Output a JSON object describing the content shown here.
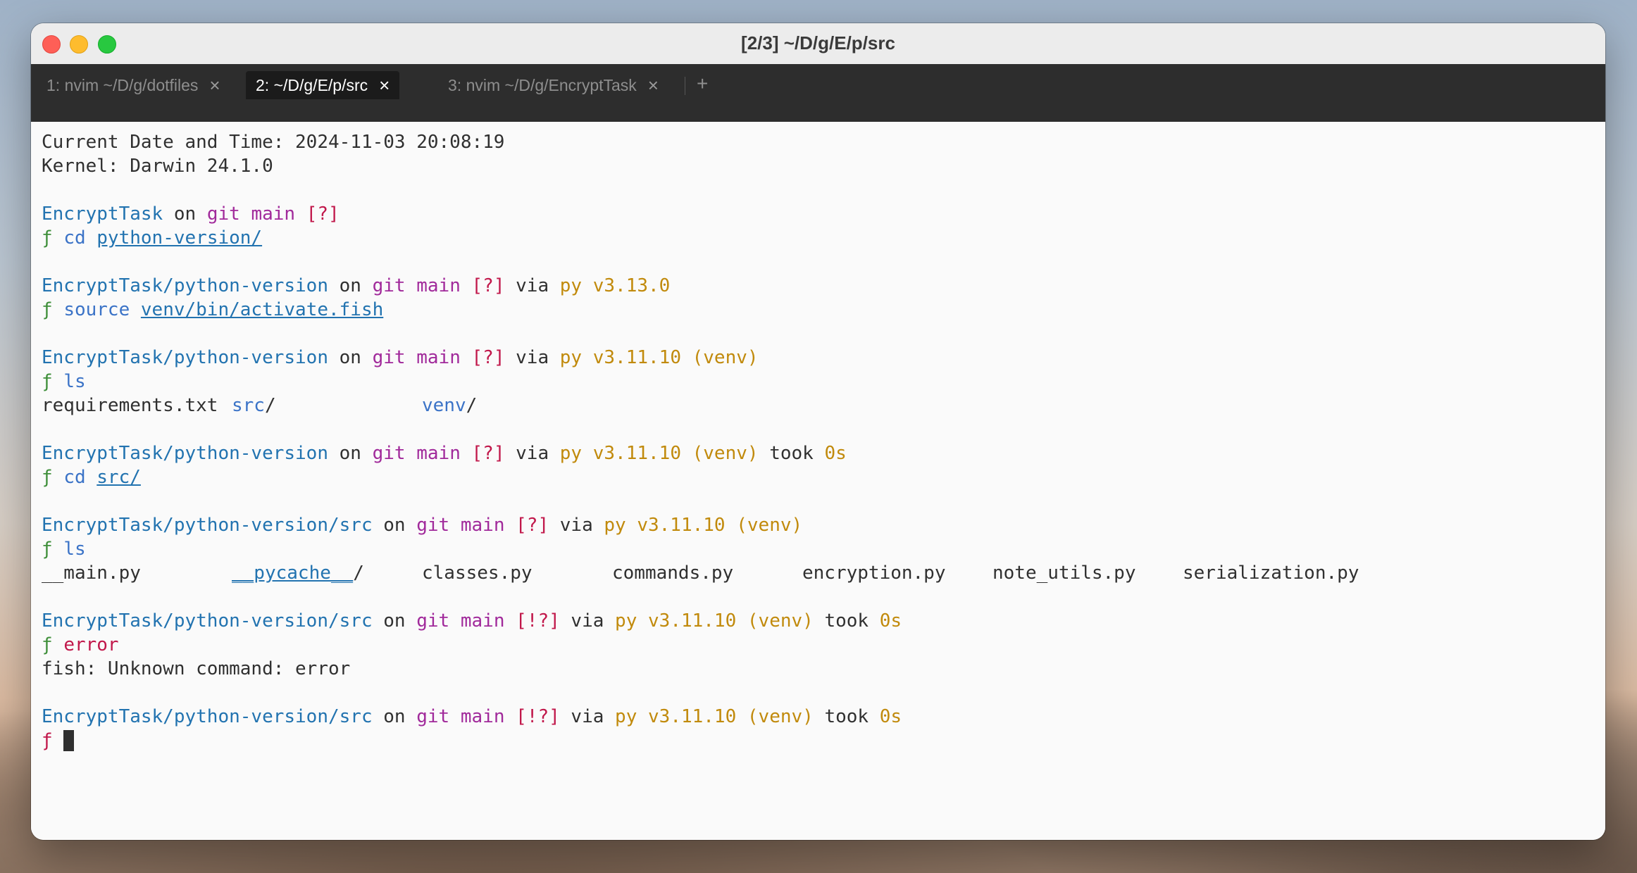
{
  "window": {
    "title": "[2/3] ~/D/g/E/p/src"
  },
  "tabs": [
    {
      "label": "1: nvim ~/D/g/dotfiles",
      "close": "×",
      "active": false
    },
    {
      "label": "2: ~/D/g/E/p/src",
      "close": "×",
      "active": true
    },
    {
      "label": "3: nvim ~/D/g/EncryptTask",
      "close": "×",
      "active": false
    }
  ],
  "new_tab": "+",
  "terminal": {
    "header": {
      "datetime": "Current Date and Time: 2024-11-03 20:08:19",
      "kernel": "Kernel: Darwin 24.1.0"
    },
    "prompt_symbol": "ƒ",
    "words": {
      "on": " on ",
      "git": "git ",
      "via": " via ",
      "took": " took "
    },
    "blocks": [
      {
        "dir": "EncryptTask",
        "branch": "main",
        "status": "[?]",
        "command": "cd",
        "arg": "python-version/"
      },
      {
        "dir": "EncryptTask/python-version",
        "branch": "main",
        "status": "[?]",
        "python": "py v3.13.0",
        "command": "source",
        "arg": "venv/bin/activate.fish"
      },
      {
        "dir": "EncryptTask/python-version",
        "branch": "main",
        "status": "[?]",
        "python": "py v3.11.10 (venv)",
        "command": "ls",
        "output": [
          "requirements.txt",
          "src",
          "venv"
        ]
      },
      {
        "dir": "EncryptTask/python-version",
        "branch": "main",
        "status": "[?]",
        "python": "py v3.11.10 (venv)",
        "took": "0s",
        "command": "cd",
        "arg": "src/"
      },
      {
        "dir": "EncryptTask/python-version/src",
        "branch": "main",
        "status": "[?]",
        "python": "py v3.11.10 (venv)",
        "command": "ls",
        "output": [
          "__main.py",
          "__pycache__",
          "classes.py",
          "commands.py",
          "encryption.py",
          "note_utils.py",
          "serialization.py"
        ]
      },
      {
        "dir": "EncryptTask/python-version/src",
        "branch": "main",
        "status": "[!?]",
        "python": "py v3.11.10 (venv)",
        "took": "0s",
        "command": "error",
        "output_text": "fish: Unknown command: error"
      },
      {
        "dir": "EncryptTask/python-version/src",
        "branch": "main",
        "status": "[!?]",
        "python": "py v3.11.10 (venv)",
        "took": "0s"
      }
    ],
    "slash": "/"
  },
  "colors": {
    "directory": "#2273b0",
    "branch": "#a12a9b",
    "git_status": "#c1184b",
    "python": "#c18a0c",
    "prompt_ok": "#3f8f3a",
    "prompt_error": "#c1184b",
    "command": "#3b73c7"
  }
}
